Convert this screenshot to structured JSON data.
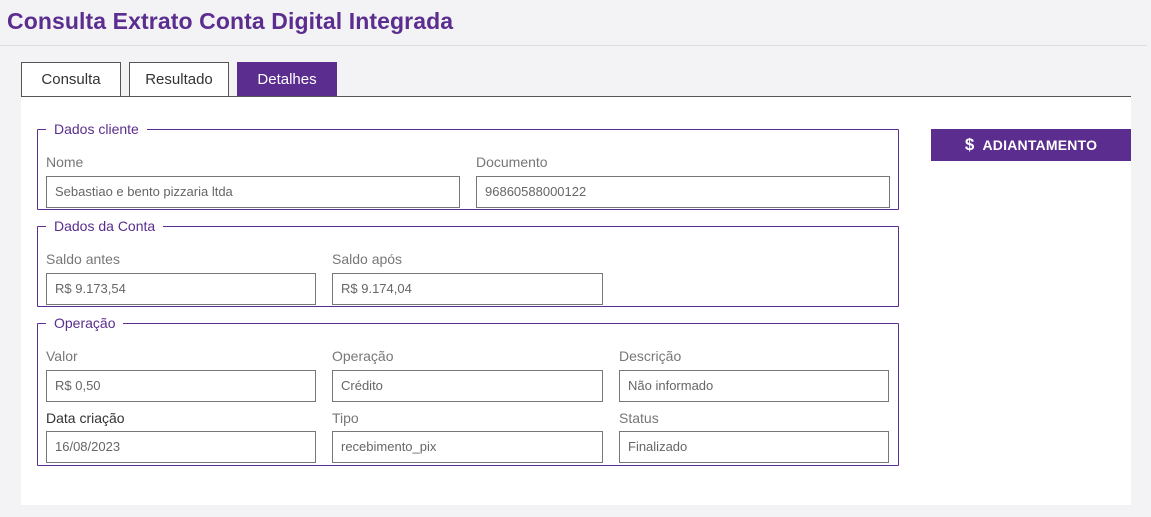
{
  "page": {
    "title": "Consulta Extrato Conta Digital Integrada"
  },
  "tabs": [
    {
      "label": "Consulta"
    },
    {
      "label": "Resultado"
    },
    {
      "label": "Detalhes",
      "active": true
    }
  ],
  "dados_cliente": {
    "legend": "Dados cliente",
    "nome": {
      "label": "Nome",
      "value": "Sebastiao e bento pizzaria ltda"
    },
    "documento": {
      "label": "Documento",
      "value": "96860588000122"
    }
  },
  "dados_conta": {
    "legend": "Dados da Conta",
    "saldo_antes": {
      "label": "Saldo antes",
      "value": "R$ 9.173,54"
    },
    "saldo_apos": {
      "label": "Saldo após",
      "value": "R$ 9.174,04"
    }
  },
  "operacao": {
    "legend": "Operação",
    "valor": {
      "label": "Valor",
      "value": "R$ 0,50"
    },
    "operacao": {
      "label": "Operação",
      "value": "Crédito"
    },
    "descricao": {
      "label": "Descrição",
      "value": "Não informado"
    },
    "data_criacao": {
      "label": "Data criação",
      "value": "16/08/2023"
    },
    "tipo": {
      "label": "Tipo",
      "value": "recebimento_pix"
    },
    "status": {
      "label": "Status",
      "value": "Finalizado"
    }
  },
  "actions": {
    "adiantamento_label": "ADIANTAMENTO",
    "adiantamento_icon": "dollar-icon"
  },
  "colors": {
    "brand": "#5b2d8e"
  }
}
